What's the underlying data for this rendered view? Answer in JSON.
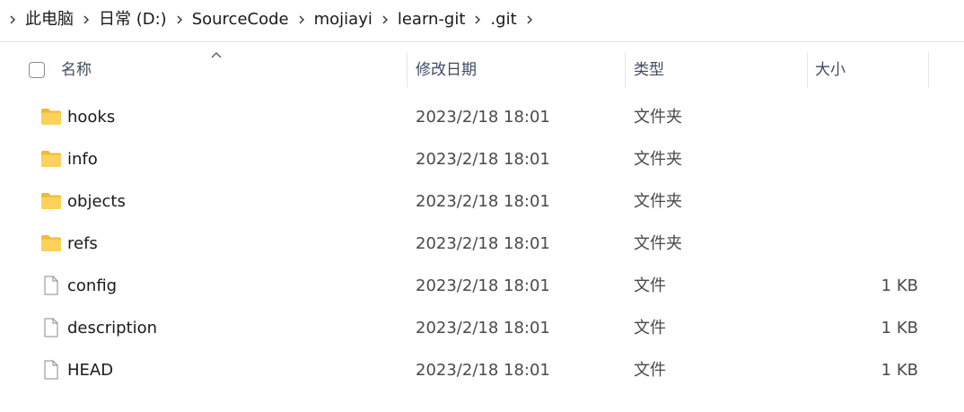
{
  "breadcrumb": {
    "items": [
      "此电脑",
      "日常 (D:)",
      "SourceCode",
      "mojiayi",
      "learn-git",
      ".git"
    ]
  },
  "columns": {
    "name": "名称",
    "date": "修改日期",
    "type": "类型",
    "size": "大小"
  },
  "colors": {
    "folder": "#f6c344",
    "header_text": "#3f4a63"
  },
  "files": [
    {
      "name": "hooks",
      "date": "2023/2/18 18:01",
      "type": "文件夹",
      "size": "",
      "icon": "folder-icon"
    },
    {
      "name": "info",
      "date": "2023/2/18 18:01",
      "type": "文件夹",
      "size": "",
      "icon": "folder-icon"
    },
    {
      "name": "objects",
      "date": "2023/2/18 18:01",
      "type": "文件夹",
      "size": "",
      "icon": "folder-icon"
    },
    {
      "name": "refs",
      "date": "2023/2/18 18:01",
      "type": "文件夹",
      "size": "",
      "icon": "folder-icon"
    },
    {
      "name": "config",
      "date": "2023/2/18 18:01",
      "type": "文件",
      "size": "1 KB",
      "icon": "file-icon"
    },
    {
      "name": "description",
      "date": "2023/2/18 18:01",
      "type": "文件",
      "size": "1 KB",
      "icon": "file-icon"
    },
    {
      "name": "HEAD",
      "date": "2023/2/18 18:01",
      "type": "文件",
      "size": "1 KB",
      "icon": "file-icon"
    }
  ]
}
